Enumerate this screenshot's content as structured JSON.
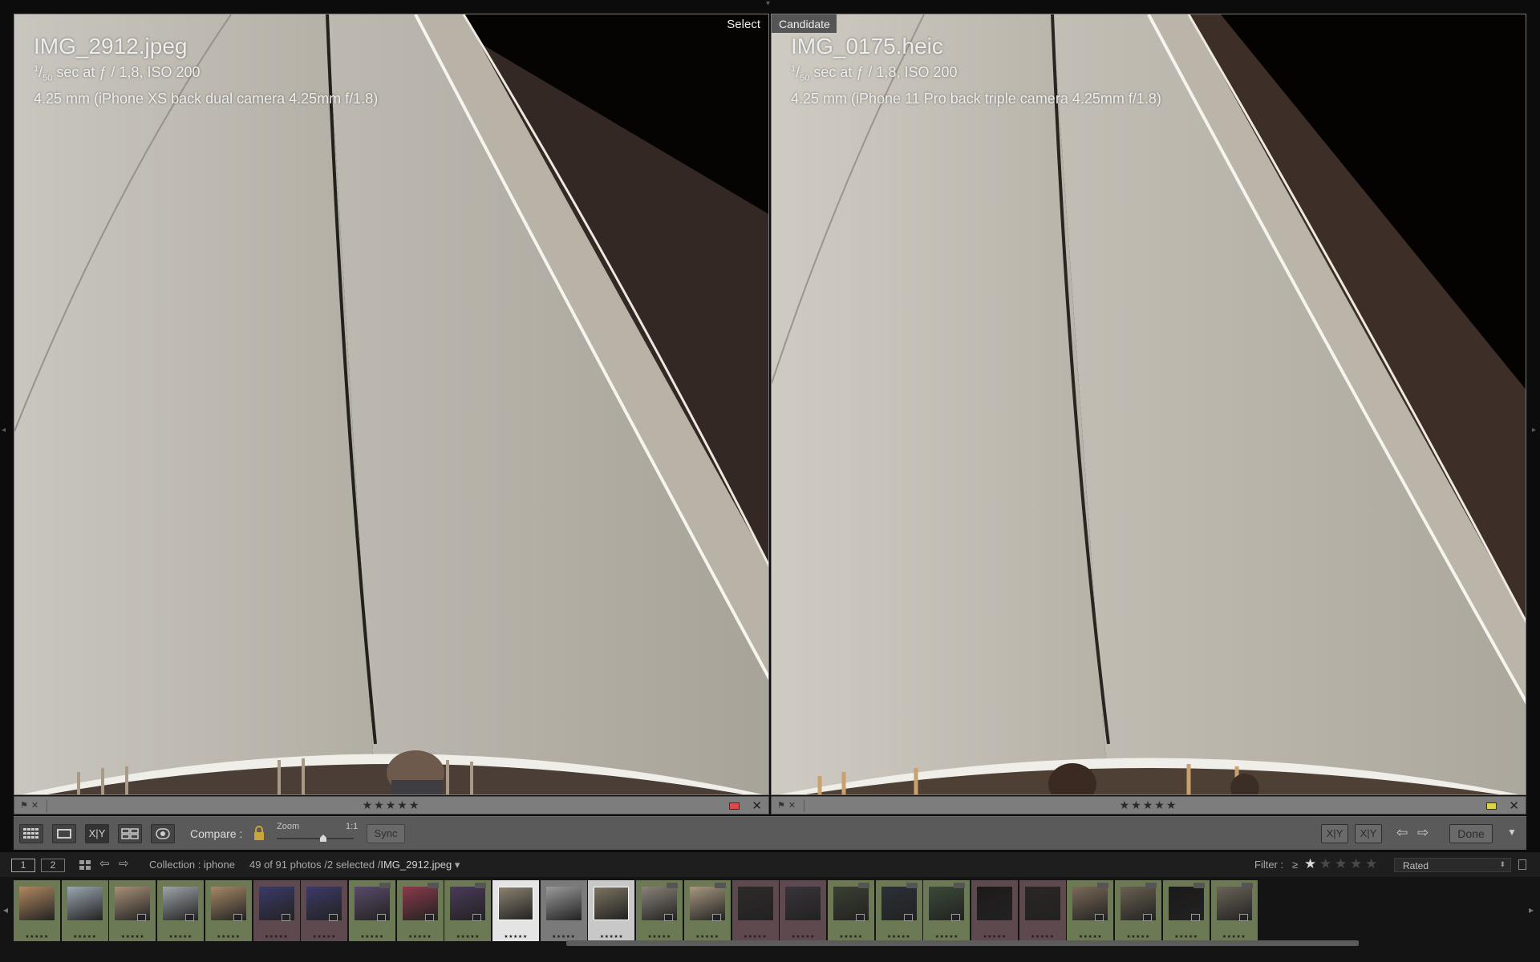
{
  "compare": {
    "left": {
      "tag": "Select",
      "filename": "IMG_2912.jpeg",
      "exposure_num": "1",
      "exposure_den": "50",
      "exposure_rest": " sec at ƒ / 1,8, ISO 200",
      "lens": "4.25 mm (iPhone XS back dual camera 4.25mm f/1.8)",
      "stars": "★★★★★",
      "label_color": "#d94a4a"
    },
    "right": {
      "tag": "Candidate",
      "filename": "IMG_0175.heic",
      "exposure_num": "1",
      "exposure_den": "50",
      "exposure_rest": " sec at ƒ / 1,8, ISO 200",
      "lens": "4.25 mm (iPhone 11 Pro back triple camera 4.25mm f/1.8)",
      "stars": "★★★★★",
      "label_color": "#d9d64a"
    }
  },
  "toolbar": {
    "compare_label": "Compare :",
    "zoom_label": "Zoom",
    "zoom_ratio": "1:1",
    "xy_label": "X|Y",
    "sync_label": "Sync",
    "done_label": "Done",
    "swap_label": "X|Y",
    "make_select_label": "X|Y"
  },
  "statusbar": {
    "page1": "1",
    "page2": "2",
    "source": "Collection : iphone",
    "count": "49 of 91 photos /2 selected /",
    "current": "IMG_2912.jpeg",
    "filter_label": "Filter :",
    "filter_op": "≥",
    "filter_value": "Rated"
  },
  "filmstrip": {
    "thumbs": [
      {
        "bg": "#6b7a55",
        "img": "#b08860"
      },
      {
        "bg": "#6b7a55",
        "img": "#9aa6b0"
      },
      {
        "bg": "#6b7a55",
        "img": "#a89078"
      },
      {
        "bg": "#6b7a55",
        "img": "#9ea4a8"
      },
      {
        "bg": "#6b7a55",
        "img": "#a58866"
      },
      {
        "bg": "#5e4a4e",
        "img": "#3a3a6a"
      },
      {
        "bg": "#5e4a4e",
        "img": "#3c3a68"
      },
      {
        "bg": "#6b7a55",
        "img": "#5a4a6a"
      },
      {
        "bg": "#6b7a55",
        "img": "#8a3a4a"
      },
      {
        "bg": "#6b7a55",
        "img": "#4a3a5a"
      },
      {
        "bg": "#e4e4e4",
        "img": "#8c8270"
      },
      {
        "bg": "#7a7a7a",
        "img": "#9a9a9a"
      },
      {
        "bg": "#c8c8c8",
        "img": "#7c7260"
      },
      {
        "bg": "#6b7a55",
        "img": "#8a8278"
      },
      {
        "bg": "#6b7a55",
        "img": "#a89880"
      },
      {
        "bg": "#5e4a4e",
        "img": "#2e2a2a"
      },
      {
        "bg": "#5e4a4e",
        "img": "#38343a"
      },
      {
        "bg": "#6b7a55",
        "img": "#3a4030"
      },
      {
        "bg": "#6b7a55",
        "img": "#2a3038"
      },
      {
        "bg": "#6b7a55",
        "img": "#3a4a38"
      },
      {
        "bg": "#5e4a4e",
        "img": "#1e1a1a"
      },
      {
        "bg": "#5e4a4e",
        "img": "#2a2624"
      },
      {
        "bg": "#6b7a55",
        "img": "#7a6a58"
      },
      {
        "bg": "#6b7a55",
        "img": "#6a6050"
      },
      {
        "bg": "#6b7a55",
        "img": "#1a1a1a"
      },
      {
        "bg": "#6b7a55",
        "img": "#6a6458"
      }
    ]
  }
}
